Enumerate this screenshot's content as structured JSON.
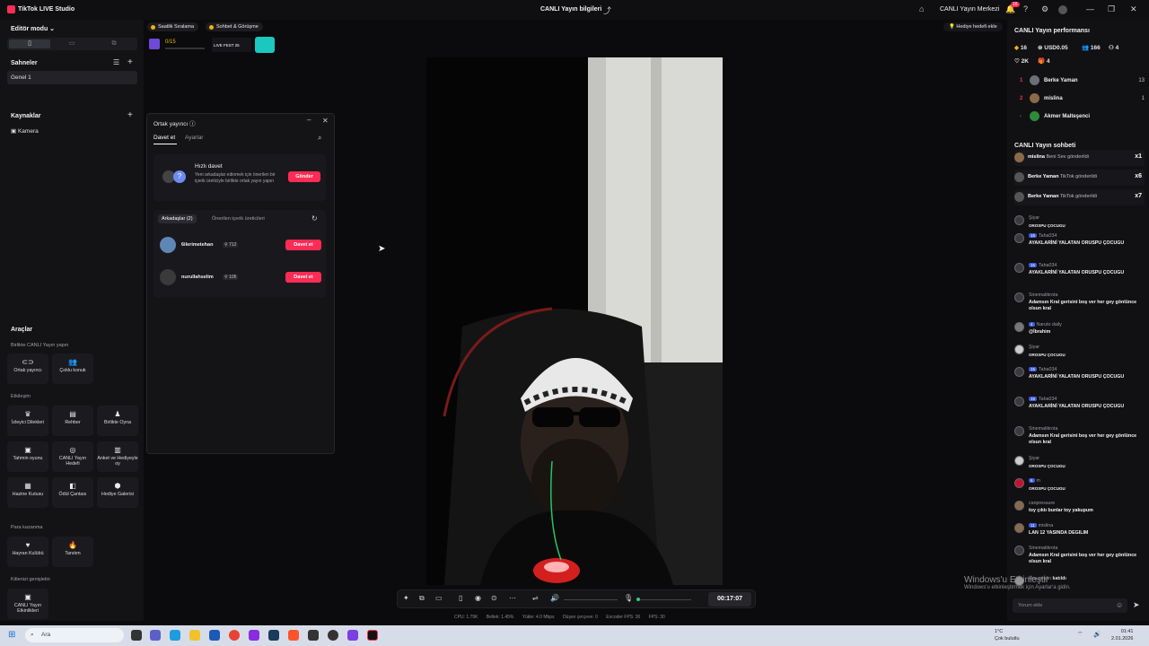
{
  "app": {
    "name": "TikTok LIVE Studio"
  },
  "header": {
    "live_info": "CANLI Yayın bilgileri",
    "live_center": "CANLI Yayın Merkezi",
    "notification_count": "16"
  },
  "left": {
    "editor_mode": "Editör modu",
    "scenes_title": "Sahneler",
    "scene_item": "Genel 1",
    "sources_title": "Kaynaklar",
    "source_camera": "Kamera",
    "tools_title": "Araçlar",
    "sections": [
      {
        "title": "Birlikte CANLI Yayın yapın"
      },
      {
        "title": "Etkileşim"
      },
      {
        "title": "Para kazanma"
      },
      {
        "title": "Kitlenizi genişletin"
      }
    ],
    "tools": [
      {
        "label": "Ortak yayıncı",
        "icon": "link-icon"
      },
      {
        "label": "Çoklu konuk",
        "icon": "users-icon"
      },
      {
        "label": "İzleyici Dilekleri",
        "icon": "wish-icon"
      },
      {
        "label": "Rehber",
        "icon": "book-icon"
      },
      {
        "label": "Birlikte Oyna",
        "icon": "play-together-icon"
      },
      {
        "label": "Tahmin oyunu",
        "icon": "guess-icon"
      },
      {
        "label": "CANLI Yayın Hedefi",
        "icon": "target-icon"
      },
      {
        "label": "Anket ve Hediyeyle oy",
        "icon": "poll-icon"
      },
      {
        "label": "Hazine Kutusu",
        "icon": "treasure-icon"
      },
      {
        "label": "Ödül Çantası",
        "icon": "bag-icon"
      },
      {
        "label": "Hediye Galerisi",
        "icon": "gift-gallery-icon"
      },
      {
        "label": "Hayran Kulübü",
        "icon": "heart-icon"
      },
      {
        "label": "Tanıtım",
        "icon": "flame-icon"
      },
      {
        "label": "CANLI Yayın Etkinlikleri",
        "icon": "events-icon"
      }
    ]
  },
  "topbar": {
    "tag1": "Saatlik Sıralama",
    "tag2": "Sohbet & Görüşme",
    "gift_progress": "0/15",
    "event_label": "LIVE FEST 25",
    "goal_button": "Hediye hedefi ekle"
  },
  "cohost": {
    "title": "Ortak yayıncı",
    "tab_invite": "Davet et",
    "tab_settings": "Ayarlar",
    "quick_title": "Hızlı davet",
    "quick_desc": "Yeni arkadaşlar edinmek için önerilen bir içerik üreticiyle birlikte ortak yayın yapın",
    "send_label": "Gönder",
    "friends_tab": "Arkadaşlar (2)",
    "suggested_tab": "Önerilen içerik üreticileri",
    "friends": [
      {
        "name": "6ilerimetehan",
        "count": "712",
        "action": "Davet et"
      },
      {
        "name": "nurullahselim",
        "count": "105",
        "action": "Davet et"
      }
    ]
  },
  "controls": {
    "timer": "00:17:07"
  },
  "stats": {
    "cpu": "CPU: 1.79K",
    "memory": "Bellek: 1.45%",
    "upload": "Yükle: 4.0 Mbps",
    "dropped": "Düşen çerçeve: 0",
    "encoder": "Encoder FPS: 30",
    "fps": "FPS: 30"
  },
  "right": {
    "perf_title": "CANLI Yayın performansı",
    "perf": {
      "diamonds": "16",
      "usd": "USD0.05",
      "viewers": "166",
      "gifters": "4",
      "likes": "2K",
      "gifts": "4"
    },
    "ranking": [
      {
        "rank": "1",
        "name": "Berke Yaman",
        "value": "13"
      },
      {
        "rank": "2",
        "name": "mislina",
        "value": "1"
      },
      {
        "rank": "-",
        "name": "Akmer Malteşenci",
        "value": ""
      }
    ],
    "chat_title": "CANLI Yayın sohbeti",
    "gifts": [
      {
        "user": "mislina",
        "text": "Beni Sev gönderildi",
        "count": "x1"
      },
      {
        "user": "Berke Yaman",
        "text": "TikTok gönderildi",
        "count": "x6"
      },
      {
        "user": "Berke Yaman",
        "text": "TikTok gönderildi",
        "count": "x7"
      }
    ],
    "messages": [
      {
        "user": "Şiyar",
        "level": "",
        "msg": "OROSPU ÇOCUGU"
      },
      {
        "user": "Taha034",
        "level": "15",
        "msg": "AYAKLARİNİ YALATAN ORUSPU ÇOCUGU"
      },
      {
        "user": "Taha034",
        "level": "15",
        "msg": "AYAKLARİNİ YALATAN ORUSPU ÇOCUGU"
      },
      {
        "user": "Sinematikrota",
        "level": "",
        "msg": "Adamsın Kral gerisini boş ver her gey gönlünce olsun kral"
      },
      {
        "user": "Naruto daily",
        "level": "4",
        "msg": "@İbrahim"
      },
      {
        "user": "Şiyar",
        "level": "",
        "msg": "OROSPU ÇOCUGU"
      },
      {
        "user": "Taha034",
        "level": "15",
        "msg": "AYAKLARİNİ YALATAN ORUSPU ÇOCUGU"
      },
      {
        "user": "Taha034",
        "level": "15",
        "msg": "AYAKLARİNİ YALATAN ORUSPU ÇOCUGU"
      },
      {
        "user": "Sinematikrota",
        "level": "",
        "msg": "Adamsın Kral gerisini boş ver her gey gönlünce olsun kral"
      },
      {
        "user": "Şiyar",
        "level": "",
        "msg": "OROSPU ÇOCUGU"
      },
      {
        "user": "m",
        "level": "6",
        "msg": "OROSPU ÇOCUGU"
      },
      {
        "user": "canpressure",
        "level": "",
        "msg": "toy çıktı bunlar toy yakupum"
      },
      {
        "user": "mislina",
        "level": "11",
        "msg": "LAN 12 YASINDA DEGILIM"
      },
      {
        "user": "Sinematikrota",
        "level": "",
        "msg": "Adamsın Kral gerisini boş ver her gey gönlünce olsun kral"
      },
      {
        "user": "Hoş geldin",
        "level": "",
        "msg": "katıldı"
      }
    ],
    "comment_placeholder": "Yorum ekle"
  },
  "watermark": {
    "line1": "Windows'u Etkinleştir",
    "line2": "Windows'u etkinleştirmek için Ayarlar'a gidin."
  },
  "taskbar": {
    "search": "Ara",
    "weather_temp": "1°C",
    "weather_desc": "Çok bulutlu",
    "time": "01:41",
    "date": "2.01.2026"
  }
}
